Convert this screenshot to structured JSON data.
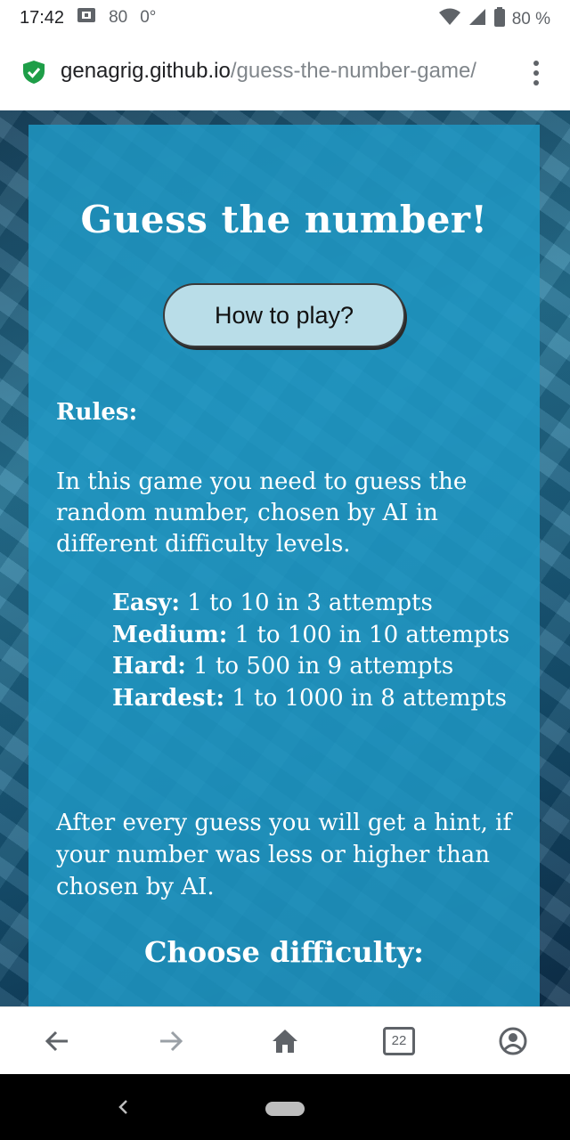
{
  "status_bar": {
    "time": "17:42",
    "notif_value": "80",
    "temperature": "0°",
    "battery": "80 %"
  },
  "browser": {
    "url_domain": "genagrig.github.io",
    "url_path": "/guess-the-number-game/",
    "tab_count": "22"
  },
  "page": {
    "title": "Guess the number!",
    "how_to_play_label": "How to play?",
    "rules_heading": "Rules:",
    "rules_intro": "In this game you need to guess the random number, chosen by AI in different difficulty levels.",
    "levels": [
      {
        "name": "Easy:",
        "desc": " 1 to 10 in 3 attempts"
      },
      {
        "name": "Medium:",
        "desc": " 1 to 100 in 10 attempts"
      },
      {
        "name": "Hard:",
        "desc": " 1 to 500 in 9 attempts"
      },
      {
        "name": "Hardest:",
        "desc": " 1 to 1000 in 8 attempts"
      }
    ],
    "hint_text": "After every guess you will get a hint, if your number was less or higher than chosen by AI.",
    "choose_heading": "Choose difficulty:"
  },
  "colors": {
    "panel": "#1e96c3",
    "button": "#b9dde8",
    "lock_green": "#1e9e48"
  }
}
